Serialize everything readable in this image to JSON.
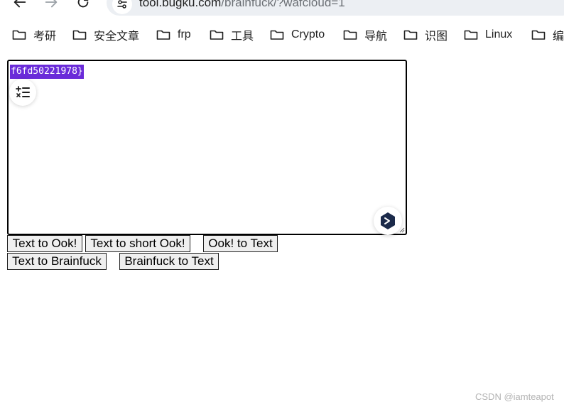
{
  "browser": {
    "url_host": "tool.bugku.com",
    "url_path": "/brainfuck/?wafcloud=1",
    "back_icon": "arrow-left-icon",
    "forward_icon": "arrow-right-icon",
    "reload_icon": "reload-icon",
    "site_info_icon": "tune-icon"
  },
  "bookmarks": [
    {
      "label": "考研"
    },
    {
      "label": "安全文章"
    },
    {
      "label": "frp"
    },
    {
      "label": "工具"
    },
    {
      "label": "Crypto"
    },
    {
      "label": "导航"
    },
    {
      "label": "识图"
    },
    {
      "label": "Linux"
    },
    {
      "label": "编"
    }
  ],
  "editor": {
    "text": "f6fd50221978}",
    "selection_color": "#6a2bd9"
  },
  "buttons": {
    "text_to_ook": "Text to Ook!",
    "text_to_short_ook": "Text to short Ook!",
    "ook_to_text": "Ook! to Text",
    "text_to_brainfuck": "Text to Brainfuck",
    "brainfuck_to_text": "Brainfuck to Text"
  },
  "watermark": "CSDN @iamteapot"
}
